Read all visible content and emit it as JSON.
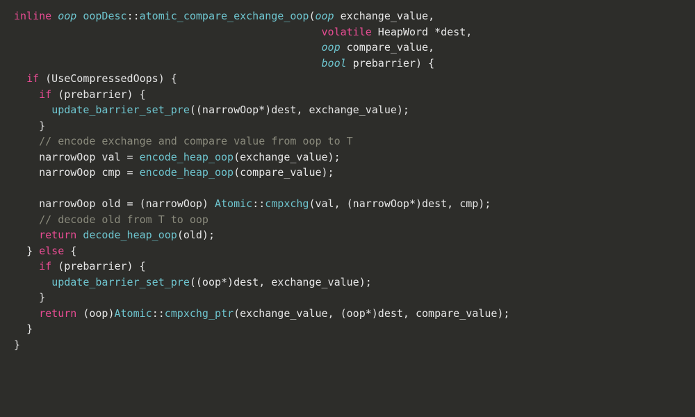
{
  "code": {
    "tokens": {
      "l1_inline": "inline",
      "l1_oop": "oop",
      "l1_scope": "oopDesc",
      "l1_scope_op": "::",
      "l1_fn": "atomic_compare_exchange_oop",
      "l1_paren_open": "(",
      "l1_p1_type": "oop",
      "l1_p1_name": "exchange_value",
      "l1_comma": ",",
      "l2_volatile": "volatile",
      "l2_type": "HeapWord",
      "l2_star": " *",
      "l2_name": "dest",
      "l2_comma": ",",
      "l3_type": "oop",
      "l3_name": "compare_value",
      "l3_comma": ",",
      "l4_type": "bool",
      "l4_name": "prebarrier",
      "l4_paren_close": ")",
      "l4_brace_open": " {",
      "l5_if": "if",
      "l5_cond": " (UseCompressedOops) {",
      "l6_if": "if",
      "l6_cond": " (prebarrier) {",
      "l7_fn": "update_barrier_set_pre",
      "l7_args": "((narrowOop*)dest, exchange_value);",
      "l8_close": "}",
      "l9_comment": "// encode exchange and compare value from oop to T",
      "l10_a": "narrowOop val = ",
      "l10_fn": "encode_heap_oop",
      "l10_args": "(exchange_value);",
      "l11_a": "narrowOop cmp = ",
      "l11_fn": "encode_heap_oop",
      "l11_args": "(compare_value);",
      "l13_a": "narrowOop old = (narrowOop) ",
      "l13_cls": "Atomic",
      "l13_sep": "::",
      "l13_fn": "cmpxchg",
      "l13_args": "(val, (narrowOop*)dest, cmp);",
      "l14_comment": "// decode old from T to oop",
      "l15_return": "return",
      "l15_fn": " decode_heap_oop",
      "l15_args": "(old);",
      "l16_close": "}",
      "l16_else": " else ",
      "l16_open": "{",
      "l17_if": "if",
      "l17_cond": " (prebarrier) {",
      "l18_fn": "update_barrier_set_pre",
      "l18_args": "((oop*)dest, exchange_value);",
      "l19_close": "}",
      "l20_return": "return",
      "l20_cast": " (oop)",
      "l20_cls": "Atomic",
      "l20_sep": "::",
      "l20_fn": "cmpxchg_ptr",
      "l20_args": "(exchange_value, (oop*)dest, compare_value);",
      "l21_close": "}",
      "l22_close": "}"
    }
  }
}
